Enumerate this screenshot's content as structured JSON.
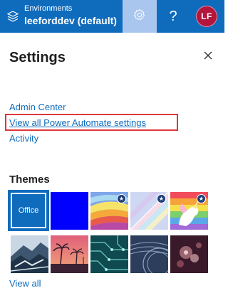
{
  "header": {
    "environment_label": "Environments",
    "environment_name": "leeforddev (default)",
    "help_label": "?",
    "avatar_initials": "LF"
  },
  "panel": {
    "title": "Settings",
    "links": {
      "admin_center": "Admin Center",
      "view_all_settings": "View all Power Automate settings",
      "activity": "Activity"
    },
    "themes_title": "Themes",
    "themes": [
      {
        "name": "Office",
        "label": "Office",
        "selected": true
      },
      {
        "name": "Blue"
      },
      {
        "name": "Rainbow",
        "featured": true
      },
      {
        "name": "Pastel",
        "featured": true
      },
      {
        "name": "Unicorn",
        "featured": true
      },
      {
        "name": "Mountain"
      },
      {
        "name": "Palm sunset"
      },
      {
        "name": "Circuit"
      },
      {
        "name": "Stamp"
      },
      {
        "name": "Bokeh"
      }
    ],
    "view_all_themes": "View all"
  },
  "colors": {
    "header_bg": "#0f6cbd",
    "gear_active_bg": "#a9c6ef",
    "avatar_bg": "#b4153c",
    "link": "#0f6cbd",
    "highlight_border": "#e0363a"
  },
  "icons": {
    "environment": "globe-icon",
    "settings": "gear-icon",
    "help": "question-icon",
    "close": "close-icon",
    "featured": "star-icon"
  }
}
